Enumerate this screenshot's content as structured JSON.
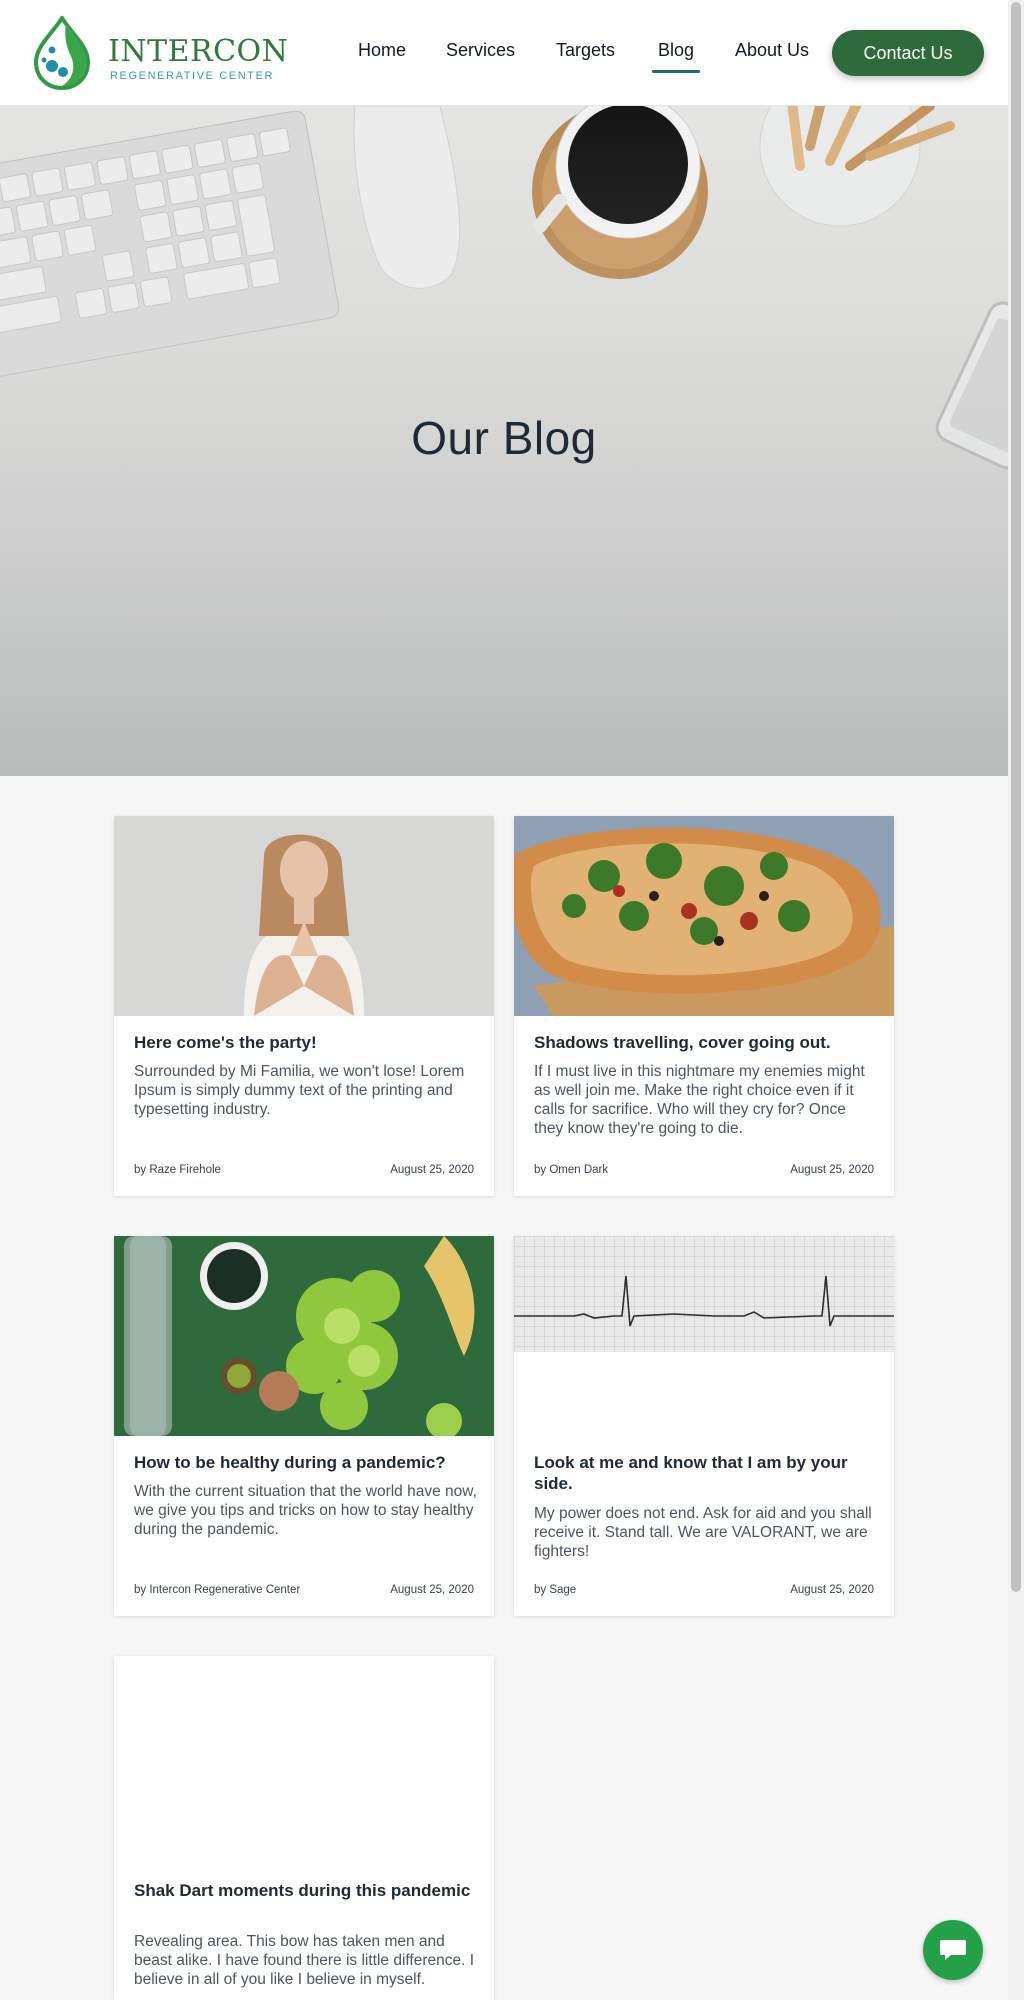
{
  "header": {
    "logo_title": "INTERCON",
    "logo_subtitle": "REGENERATIVE CENTER",
    "nav": {
      "home": "Home",
      "services": "Services",
      "targets": "Targets",
      "blog": "Blog",
      "about": "About Us"
    },
    "active_nav": "Blog",
    "contact_label": "Contact Us"
  },
  "hero": {
    "title": "Our Blog"
  },
  "posts": [
    {
      "title": "Here come's the party!",
      "excerpt": "Surrounded by Mi Familia, we won't lose! Lorem Ipsum is simply dummy text of the printing and typesetting industry.",
      "author": "by Raze Firehole",
      "date": "August 25, 2020",
      "image": "meditation-woman"
    },
    {
      "title": "Shadows travelling, cover going out.",
      "excerpt": "If I must live in this nightmare my enemies might as well join me. Make the right choice even if it calls for sacrifice. Who will they cry for? Once they know they're going to die.",
      "author": "by Omen Dark",
      "date": "August 25, 2020",
      "image": "pizza"
    },
    {
      "title": "How to be healthy during a pandemic?",
      "excerpt": "With the current situation that the world have now, we give you tips and tricks on how to stay healthy during the pandemic.",
      "author": "by Intercon Regenerative Center",
      "date": "August 25, 2020",
      "image": "healthy-food"
    },
    {
      "title": "Look at me and know that I am by your side.",
      "excerpt": "My power does not end. Ask for aid and you shall receive it. Stand tall. We are VALORANT, we are fighters!",
      "author": "by Sage",
      "date": "August 25, 2020",
      "image": "ecg-strip"
    },
    {
      "title": "Shak Dart moments during this pandemic",
      "excerpt": "Revealing area. This bow has taken men and beast alike. I have found there is little difference. I believe in all of you like I believe in myself.",
      "author": "",
      "date": "",
      "image": ""
    }
  ],
  "colors": {
    "brand_green": "#2e6b3a",
    "accent_teal": "#1e6b6b",
    "chat_green": "#24a148"
  },
  "icons": {
    "chat": "chat-bubble-icon"
  }
}
